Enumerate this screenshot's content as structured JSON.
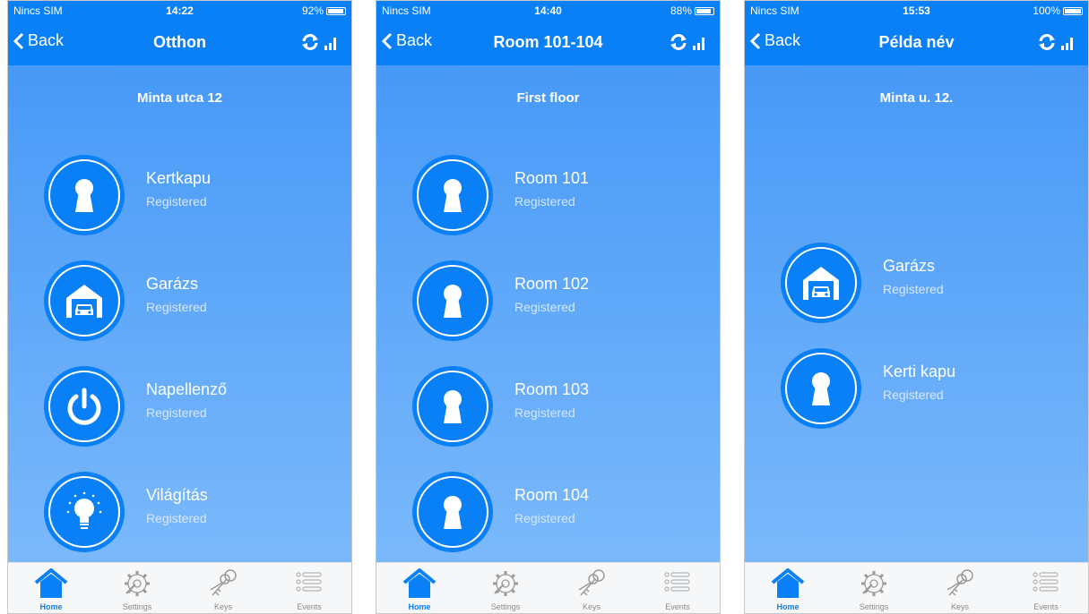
{
  "screens": [
    {
      "status": {
        "carrier": "Nincs SIM",
        "time": "14:22",
        "battery": "92%",
        "battery_level": 0.92
      },
      "nav": {
        "back": "Back",
        "title": "Otthon"
      },
      "location": "Minta utca 12",
      "devices": [
        {
          "name": "Kertkapu",
          "status": "Registered",
          "icon": "keyhole-icon"
        },
        {
          "name": "Garázs",
          "status": "Registered",
          "icon": "garage-icon"
        },
        {
          "name": "Napellenző",
          "status": "Registered",
          "icon": "power-icon"
        },
        {
          "name": "Világítás",
          "status": "Registered",
          "icon": "lightbulb-icon"
        }
      ]
    },
    {
      "status": {
        "carrier": "Nincs SIM",
        "time": "14:40",
        "battery": "88%",
        "battery_level": 0.88
      },
      "nav": {
        "back": "Back",
        "title": "Room 101-104"
      },
      "location": "First floor",
      "devices": [
        {
          "name": "Room 101",
          "status": "Registered",
          "icon": "keyhole-icon"
        },
        {
          "name": "Room 102",
          "status": "Registered",
          "icon": "keyhole-icon"
        },
        {
          "name": "Room 103",
          "status": "Registered",
          "icon": "keyhole-icon"
        },
        {
          "name": "Room 104",
          "status": "Registered",
          "icon": "keyhole-icon"
        }
      ]
    },
    {
      "status": {
        "carrier": "Nincs SIM",
        "time": "15:53",
        "battery": "100%",
        "battery_level": 1.0
      },
      "nav": {
        "back": "Back",
        "title": "Példa név"
      },
      "location": "Minta u. 12.",
      "devices": [
        {
          "name": "Garázs",
          "status": "Registered",
          "icon": "garage-icon"
        },
        {
          "name": "Kerti kapu",
          "status": "Registered",
          "icon": "keyhole-icon"
        }
      ]
    }
  ],
  "tabs": [
    {
      "label": "Home",
      "icon": "home-icon",
      "active": true
    },
    {
      "label": "Settings",
      "icon": "settings-gear-icon",
      "active": false
    },
    {
      "label": "Keys",
      "icon": "keys-icon",
      "active": false
    },
    {
      "label": "Events",
      "icon": "events-list-icon",
      "active": false
    }
  ],
  "colors": {
    "primary": "#0a80f7",
    "background_top": "#4799f7",
    "background_bottom": "#7bb9fb",
    "tab_bar": "#f6f7f8"
  }
}
